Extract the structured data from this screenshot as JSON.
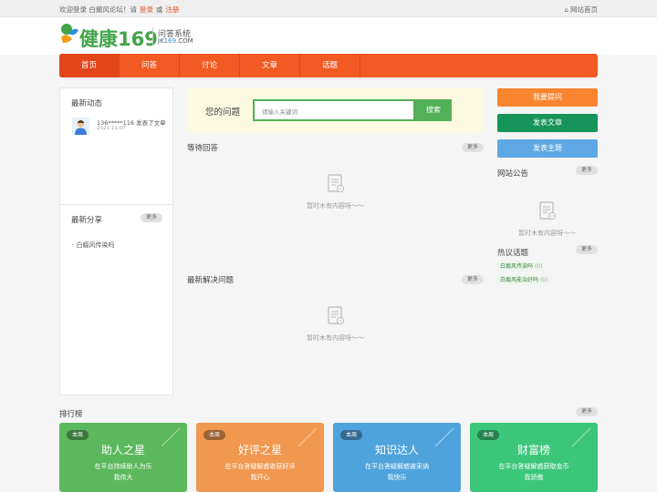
{
  "topbar": {
    "welcome": "欢迎登录 白癜风论坛！请",
    "login": "登录",
    "or": "或",
    "register": "注册",
    "home": "网站首页"
  },
  "logo": {
    "brand": "健康169",
    "sub1": "问答系统",
    "sub2_a": "JK",
    "sub2_b": "169",
    "sub2_c": ".COM"
  },
  "nav": [
    "首页",
    "问答",
    "讨论",
    "文章",
    "话题"
  ],
  "left": {
    "activity_title": "最新动态",
    "activity_text": "136*****116 发表了文章",
    "activity_date": "2021-11-07",
    "share_title": "最新分享",
    "more": "更多",
    "share_item": "· 白癜风传染吗"
  },
  "search": {
    "label": "您的问题",
    "placeholder": "请输入关键词",
    "button": "搜索"
  },
  "middle": {
    "waiting_title": "等待回答",
    "solved_title": "最新解决问题",
    "more": "更多",
    "empty": "暂时木有内容呀～～"
  },
  "right": {
    "ask": "我要提问",
    "post_article": "发表文章",
    "post_topic": "发表主题",
    "notice_title": "网站公告",
    "more": "更多",
    "empty": "暂时木有内容呀～～",
    "hot_title": "热议话题",
    "hot_topics": [
      {
        "name": "白癜风传染吗",
        "count": "(0)"
      },
      {
        "name": "白癜风能治好吗",
        "count": "(0)"
      }
    ]
  },
  "rank": {
    "title": "排行榜",
    "more": "更多",
    "cards": [
      {
        "badge": "本周",
        "title": "助人之星",
        "line1": "在平台持续助人为乐",
        "line2": "我伟大",
        "color": "#5cb85c"
      },
      {
        "badge": "本周",
        "title": "好评之星",
        "line1": "在平台答疑解惑收获好评",
        "line2": "我开心",
        "color": "#f0984f"
      },
      {
        "badge": "本周",
        "title": "知识达人",
        "line1": "在平台答疑解惑被采纳",
        "line2": "我快乐",
        "color": "#4fa3dd"
      },
      {
        "badge": "本周",
        "title": "财富榜",
        "line1": "在平台答疑解惑获取金币",
        "line2": "我骄傲",
        "color": "#3cc67a"
      }
    ]
  },
  "colors": {
    "nav": "#f15a22",
    "ask": "#f98530",
    "article": "#16955a",
    "topic": "#5da8e4",
    "search_green": "#52b057"
  }
}
